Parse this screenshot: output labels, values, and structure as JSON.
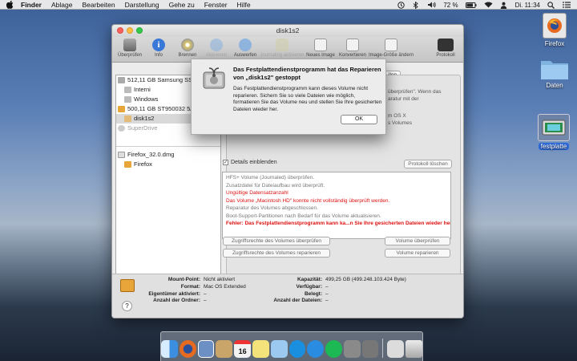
{
  "menubar": {
    "apple": "",
    "items": [
      "Finder",
      "Ablage",
      "Bearbeiten",
      "Darstellung",
      "Gehe zu",
      "Fenster",
      "Hilfe"
    ],
    "battery": "72 %",
    "clock": "Di. 11:34"
  },
  "desktop": {
    "icons": [
      {
        "label": "Firefox"
      },
      {
        "label": "Daten"
      },
      {
        "label": "festplatte"
      }
    ]
  },
  "window": {
    "title": "disk1s2",
    "toolbar": [
      {
        "label": "Überprüfen",
        "icon": "microscope-icon",
        "enabled": true
      },
      {
        "label": "Info",
        "icon": "info-icon",
        "enabled": true
      },
      {
        "label": "Brennen",
        "icon": "burn-icon",
        "enabled": true
      },
      {
        "label": "Aktivieren",
        "icon": "mount-icon",
        "enabled": false
      },
      {
        "label": "Auswerfen",
        "icon": "eject-icon",
        "enabled": true
      },
      {
        "label": "Journaling aktivieren",
        "icon": "journal-icon",
        "enabled": false
      },
      {
        "label": "Neues Image",
        "icon": "new-image-icon",
        "enabled": true
      },
      {
        "label": "Konvertieren",
        "icon": "convert-icon",
        "enabled": true
      },
      {
        "label": "Image-Größe ändern",
        "icon": "resize-image-icon",
        "enabled": true
      }
    ],
    "toolbar_right": {
      "label": "Protokoll",
      "icon": "log-icon"
    },
    "sidebar": {
      "items": [
        {
          "label": "512,11 GB Samsung SSD",
          "level": 0
        },
        {
          "label": "Interni",
          "level": 1
        },
        {
          "label": "Windows",
          "level": 1
        },
        {
          "label": "500,11 GB ST950032 5A...",
          "level": 0
        },
        {
          "label": "disk1s2",
          "level": 1,
          "selected": true
        },
        {
          "label": "SuperDrive",
          "level": 0,
          "dim": true
        }
      ],
      "images": [
        {
          "label": "Firefox_32.0.dmg",
          "level": 0
        },
        {
          "label": "Firefox",
          "level": 1
        }
      ]
    },
    "tab_label": "llen",
    "background_text": [
      "überprüfen\". Wenn das",
      "aratur mit der",
      "m OS X",
      "s Volumes"
    ],
    "details_label": "Details einblenden",
    "clear_log_button": "Protokoll löschen",
    "log_lines": [
      {
        "text": "HFS+ Volume (Journaled) überprüfen.",
        "style": "normal"
      },
      {
        "text": "Zusatzdatei für Dateiaufbau wird überprüft.",
        "style": "normal"
      },
      {
        "text": "Ungültige Datensatzanzahl",
        "style": "red"
      },
      {
        "text": "Das Volume „Macintosh HD\" konnte nicht vollständig überprüft werden.",
        "style": "red"
      },
      {
        "text": "Reparatur des Volumes abgeschlossen.",
        "style": "normal"
      },
      {
        "text": "Boot-Support-Partitionen nach Bedarf für das Volume aktualisieren.",
        "style": "normal"
      },
      {
        "text": "Fehler: Das Festplattendienstprogramm kann ka...n Sie Ihre gesicherten Dateien wieder her.",
        "style": "red-bold"
      }
    ],
    "buttons": {
      "verify_permissions": "Zugriffsrechte des Volumes überprüfen",
      "repair_permissions": "Zugriffsrechte des Volumes reparieren",
      "verify_volume": "Volume überprüfen",
      "repair_volume": "Volume reparieren"
    },
    "info": {
      "left": [
        {
          "key": "Mount-Point:",
          "value": "Nicht aktiviert"
        },
        {
          "key": "Format:",
          "value": "Mac OS Extended"
        },
        {
          "key": "Eigentümer aktiviert:",
          "value": "–"
        },
        {
          "key": "Anzahl der Ordner:",
          "value": "–"
        }
      ],
      "right": [
        {
          "key": "Kapazität:",
          "value": "499,25 GB (499.248.103.424 Byte)"
        },
        {
          "key": "Verfügbar:",
          "value": "–"
        },
        {
          "key": "Belegt:",
          "value": "–"
        },
        {
          "key": "Anzahl der Dateien:",
          "value": "–"
        }
      ],
      "help_label": "?"
    }
  },
  "dialog": {
    "title": "Das Festplattendienstprogramm hat das Reparieren von „disk1s2\" gestoppt",
    "message": "Das Festplattendienstprogramm kann dieses Volume nicht reparieren. Sichern Sie so viele Dateien wie möglich, formatieren Sie das Volume neu und stellen Sie Ihre gesicherten Dateien wieder her.",
    "ok_label": "OK"
  },
  "dock": {
    "apps": [
      {
        "name": "finder-icon",
        "color": "#3b8ee0"
      },
      {
        "name": "firefox-icon",
        "color": "#e66a1f"
      },
      {
        "name": "preview-icon",
        "color": "#6c8fc4"
      },
      {
        "name": "mail-icon",
        "color": "#c9a56a"
      },
      {
        "name": "calendar-icon",
        "color": "#f2f2f2"
      },
      {
        "name": "notes-icon",
        "color": "#f4e27a"
      },
      {
        "name": "photos-icon",
        "color": "#9cc9ef"
      },
      {
        "name": "itunes-icon",
        "color": "#1a8fe0"
      },
      {
        "name": "appstore-icon",
        "color": "#2a8ce0"
      },
      {
        "name": "spotify-icon",
        "color": "#1db954"
      },
      {
        "name": "system-prefs-icon",
        "color": "#8a8a8a"
      },
      {
        "name": "disk-utility-icon",
        "color": "#777777"
      }
    ],
    "calendar_day": "16"
  }
}
